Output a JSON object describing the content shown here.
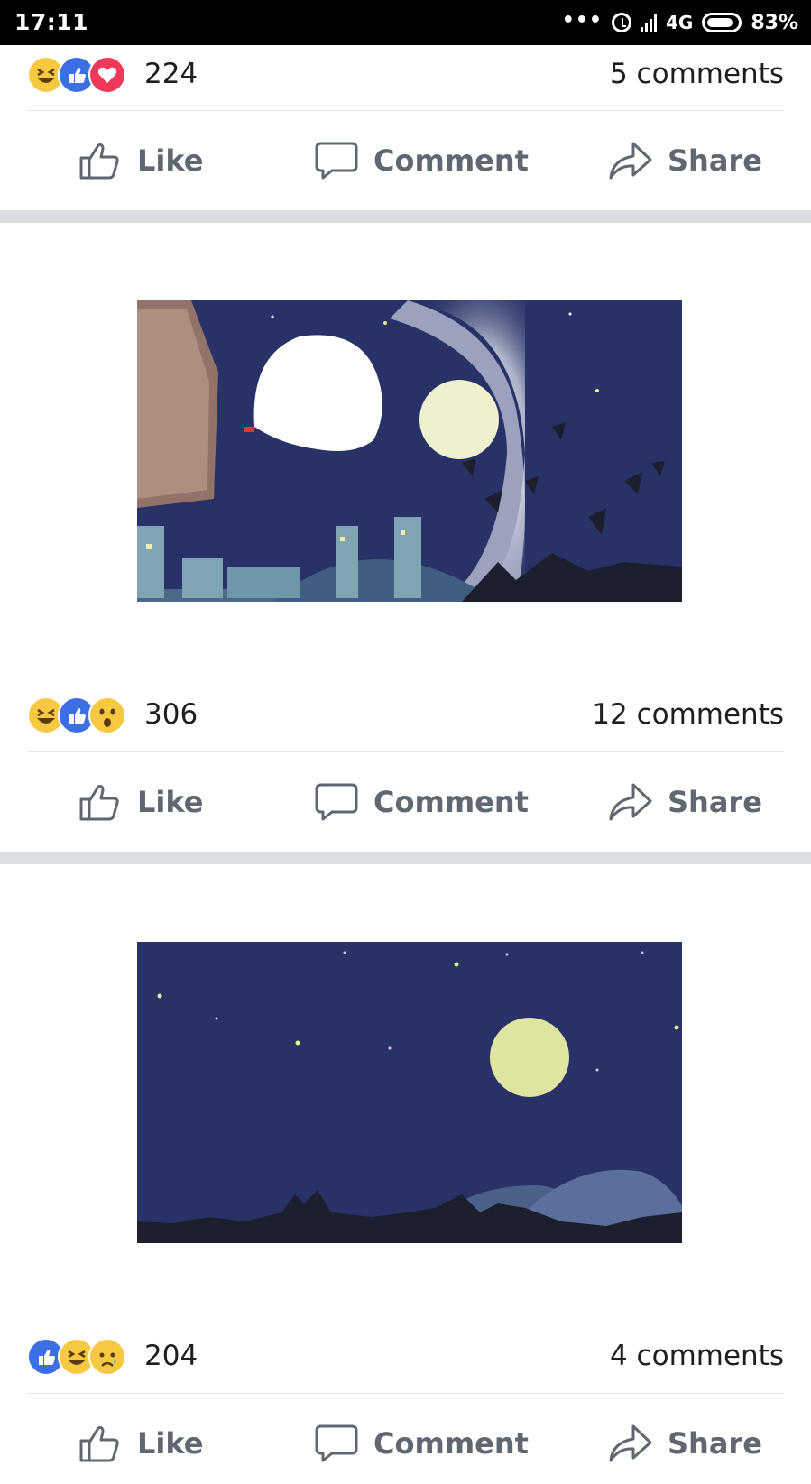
{
  "status_bar": {
    "time": "17:11",
    "dots": "•••",
    "network": "4G",
    "battery": "83%"
  },
  "actions": {
    "like": "Like",
    "comment": "Comment",
    "share": "Share"
  },
  "posts": [
    {
      "reaction_count": "224",
      "comments": "5 comments",
      "reactions": [
        "haha",
        "like",
        "love"
      ]
    },
    {
      "reaction_count": "306",
      "comments": "12 comments",
      "reactions": [
        "haha",
        "like",
        "wow"
      ]
    },
    {
      "reaction_count": "204",
      "comments": "4 comments",
      "reactions": [
        "like",
        "haha",
        "sad"
      ]
    }
  ],
  "colors": {
    "like_blue": "#3b6fe3",
    "love_red": "#f0385a",
    "emoji_yellow": "#f7c942",
    "night_sky": "#283266",
    "moon": "#dfe5a0"
  }
}
